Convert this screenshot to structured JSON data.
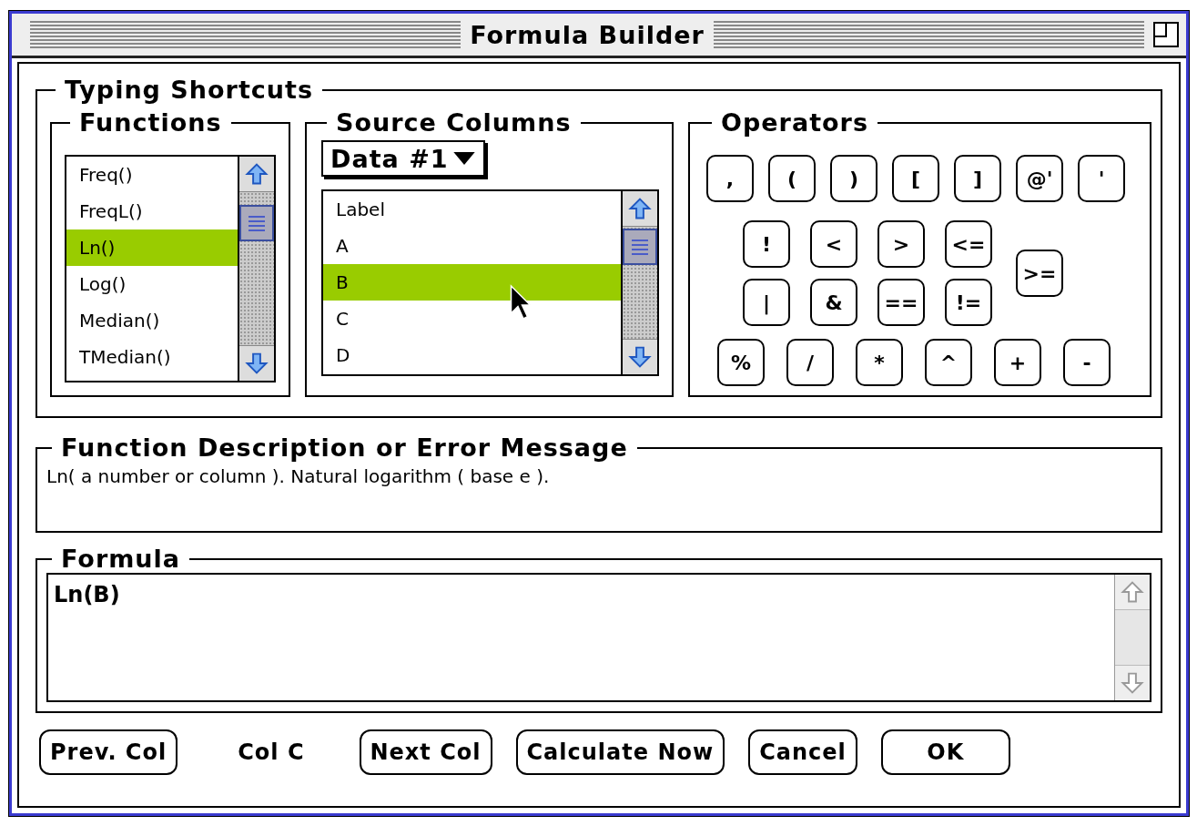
{
  "window": {
    "title": "Formula Builder"
  },
  "typing_shortcuts": {
    "title": "Typing Shortcuts",
    "functions": {
      "title": "Functions",
      "items": [
        {
          "label": "Freq()",
          "selected": false
        },
        {
          "label": "FreqL()",
          "selected": false
        },
        {
          "label": "Ln()",
          "selected": true
        },
        {
          "label": "Log()",
          "selected": false
        },
        {
          "label": "Median()",
          "selected": false
        },
        {
          "label": "TMedian()",
          "selected": false
        }
      ]
    },
    "source_columns": {
      "title": "Source Columns",
      "dataset": "Data #1",
      "items": [
        {
          "label": "Label",
          "selected": false
        },
        {
          "label": "A",
          "selected": false
        },
        {
          "label": "B",
          "selected": true
        },
        {
          "label": "C",
          "selected": false
        },
        {
          "label": "D",
          "selected": false
        }
      ]
    },
    "operators": {
      "title": "Operators",
      "top_row": [
        ",",
        "(",
        ")",
        "[",
        "]",
        "@'",
        "'"
      ],
      "middle_block": [
        "!",
        "<",
        ">",
        "<=",
        "|",
        "&",
        "==",
        "!="
      ],
      "middle_side": ">=",
      "bottom_row": [
        "%",
        "/",
        "*",
        "^",
        "+",
        "-"
      ]
    }
  },
  "description": {
    "title": "Function Description or Error Message",
    "text": "Ln( a number or column ).  Natural logarithm ( base e )."
  },
  "formula": {
    "title": "Formula",
    "value": "Ln(B)"
  },
  "footer": [
    {
      "kind": "button",
      "label": "Prev. Col"
    },
    {
      "kind": "label",
      "label": "Col C"
    },
    {
      "kind": "button",
      "label": "Next Col"
    },
    {
      "kind": "button",
      "label": "Calculate Now"
    },
    {
      "kind": "button",
      "label": "Cancel"
    },
    {
      "kind": "button",
      "label": "OK"
    }
  ]
}
